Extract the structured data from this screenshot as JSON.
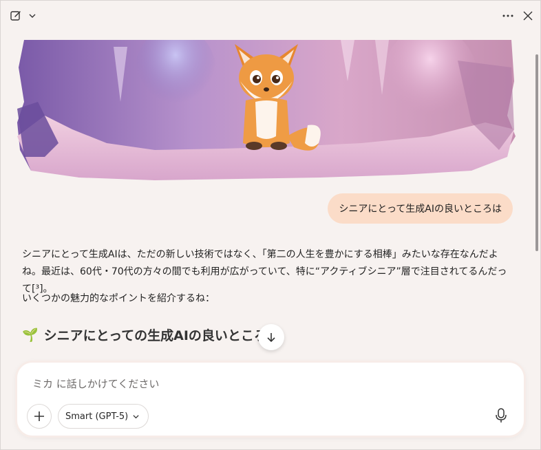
{
  "topbar": {
    "new_chat_icon": "compose-icon",
    "more_icon": "more-icon",
    "close_icon": "close-icon"
  },
  "conversation": {
    "user_message": "シニアにとって生成AIの良いところは",
    "assistant_paragraph_1": "シニアにとって生成AIは、ただの新しい技術ではなく、「第二の人生を豊かにする相棒」みたいな存在なんだよね。最近は、60代・70代の方々の間でも利用が広がっていて、特に“アクティブシニア”層で注目されてるんだって[³]。",
    "assistant_paragraph_2": "いくつかの魅力的なポイントを紹介するね：",
    "heading_emoji": "🌱",
    "heading": "シニアにとっての生成AIの良いところ"
  },
  "composer": {
    "placeholder": "ミカ に話しかけてください",
    "model_label": "Smart (GPT-5)"
  },
  "colors": {
    "user_bubble": "#fbdcc8",
    "background": "#f7f2f0"
  }
}
